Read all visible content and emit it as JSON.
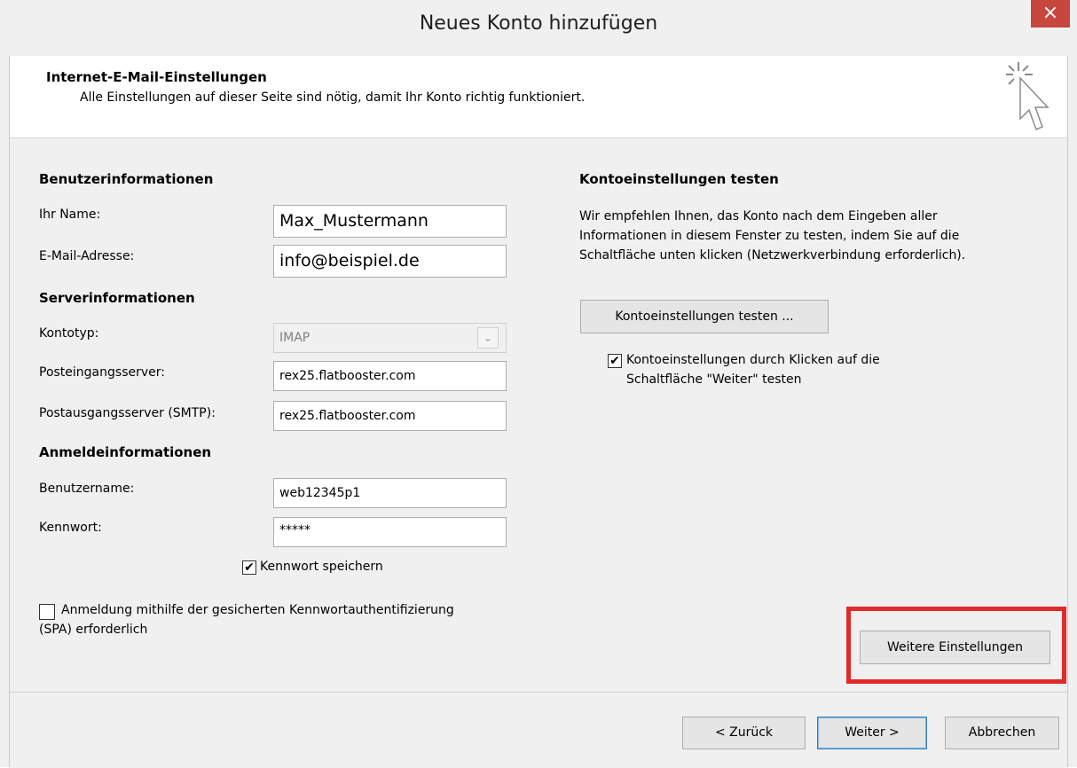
{
  "window": {
    "title": "Neues Konto hinzufügen",
    "close_label": "×"
  },
  "header": {
    "title": "Internet-E-Mail-Einstellungen",
    "subtitle": "Alle Einstellungen auf dieser Seite sind nötig, damit Ihr Konto richtig funktioniert.",
    "icon": "cursor-sparkle-icon"
  },
  "user_info": {
    "heading": "Benutzerinformationen",
    "name_label": "Ihr Name:",
    "name_value": "Max_Mustermann",
    "email_label": "E-Mail-Adresse:",
    "email_value": "info@beispiel.de"
  },
  "server_info": {
    "heading": "Serverinformationen",
    "account_type_label": "Kontotyp:",
    "account_type_value": "IMAP",
    "incoming_label": "Posteingangsserver:",
    "incoming_value": "rex25.flatbooster.com",
    "outgoing_label": "Postausgangsserver (SMTP):",
    "outgoing_value": "rex25.flatbooster.com"
  },
  "login_info": {
    "heading": "Anmeldeinformationen",
    "username_label": "Benutzername:",
    "username_value": "web12345p1",
    "password_label": "Kennwort:",
    "password_value": "*****",
    "save_password_label": "Kennwort speichern",
    "save_password_checked": true,
    "spa_label_line1": "Anmeldung mithilfe der gesicherten Kennwortauthentifizierung",
    "spa_label_line2": "(SPA) erforderlich",
    "spa_checked": false
  },
  "test": {
    "heading": "Kontoeinstellungen testen",
    "desc_line1": "Wir empfehlen Ihnen, das Konto nach dem Eingeben aller",
    "desc_line2": "Informationen in diesem Fenster zu testen, indem Sie auf die",
    "desc_line3": "Schaltfläche unten klicken (Netzwerkverbindung erforderlich).",
    "test_button": "Kontoeinstellungen testen ...",
    "auto_test_line1": "Kontoeinstellungen durch Klicken auf die",
    "auto_test_line2": "Schaltfläche \"Weiter\" testen",
    "auto_test_checked": true
  },
  "more_settings_button": "Weitere Einstellungen",
  "footer": {
    "back": "< Zurück",
    "next": "Weiter >",
    "cancel": "Abbrechen"
  },
  "colors": {
    "highlight": "#e12a2a",
    "close": "#c7473f"
  }
}
